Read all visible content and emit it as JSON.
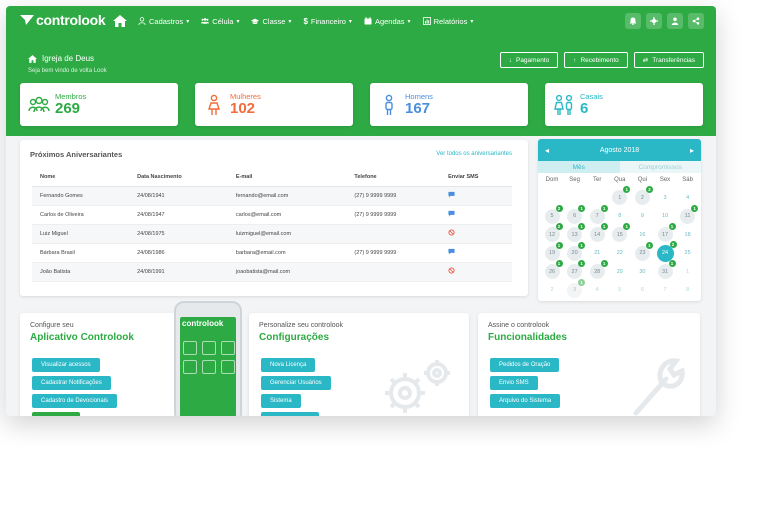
{
  "app": {
    "logo_text": "controlook",
    "colors": {
      "primary": "#2eaa44",
      "accent": "#2ab8c6",
      "orange": "#f26b3a",
      "blue": "#4a8ee0"
    }
  },
  "nav": {
    "menu": [
      {
        "label": "Cadastros",
        "icon": "user-icon"
      },
      {
        "label": "Célula",
        "icon": "group-icon"
      },
      {
        "label": "Classe",
        "icon": "graduation-icon"
      },
      {
        "label": "Financeiro",
        "icon": "dollar-icon"
      },
      {
        "label": "Agendas",
        "icon": "calendar-icon"
      },
      {
        "label": "Relatórios",
        "icon": "chart-icon"
      }
    ],
    "right_icons": [
      "bell-icon",
      "gear-icon",
      "user-icon",
      "share-icon"
    ]
  },
  "header": {
    "org_name": "Igreja de Deus",
    "welcome": "Seja bem vindo de volta Look",
    "actions": [
      {
        "label": "Pagamento",
        "icon": "arrow-down-icon"
      },
      {
        "label": "Recebimento",
        "icon": "arrow-up-icon"
      },
      {
        "label": "Transferências",
        "icon": "transfer-icon"
      }
    ]
  },
  "stats": [
    {
      "label": "Membros",
      "value": "269",
      "color": "#2eaa44",
      "icon": "members-icon"
    },
    {
      "label": "Mulheres",
      "value": "102",
      "color": "#f26b3a",
      "icon": "woman-icon"
    },
    {
      "label": "Homens",
      "value": "167",
      "color": "#4a8ee0",
      "icon": "man-icon"
    },
    {
      "label": "Casais",
      "value": "6",
      "color": "#2ab8c6",
      "icon": "couple-icon"
    }
  ],
  "birthdays": {
    "title": "Próximos Aniversariantes",
    "link": "Ver todos os aniversariantes",
    "columns": [
      "Nome",
      "Data Nascimento",
      "E-mail",
      "Telefone",
      "Enviar SMS"
    ],
    "rows": [
      {
        "name": "Fernando Gomes",
        "date": "24/08/1941",
        "email": "fernando@email.com",
        "phone": "(27) 9 9999 9999",
        "sms": "chat"
      },
      {
        "name": "Carlos de Oliveira",
        "date": "24/08/1947",
        "email": "carlos@email.com",
        "phone": "(27) 9 9999 9999",
        "sms": "chat"
      },
      {
        "name": "Luiz Miguel",
        "date": "24/08/1975",
        "email": "luizmiguel@email.com",
        "phone": "",
        "sms": "blocked"
      },
      {
        "name": "Bárbara Brasil",
        "date": "24/08/1986",
        "email": "barbara@email.com",
        "phone": "(27) 9 9999 9999",
        "sms": "chat"
      },
      {
        "name": "João Batista",
        "date": "24/08/1991",
        "email": "joaobatista@mail.com",
        "phone": "",
        "sms": "blocked"
      }
    ]
  },
  "calendar": {
    "month": "Agosto 2018",
    "tabs": [
      "Mês",
      "Compromissos"
    ],
    "weekdays": [
      "Dom",
      "Seg",
      "Ter",
      "Qua",
      "Qui",
      "Sex",
      "Sáb"
    ],
    "today": 24,
    "days": [
      {
        "d": "1",
        "b": "1"
      },
      {
        "d": "2",
        "b": "3"
      },
      {
        "d": "3",
        "b": ""
      },
      {
        "d": "4",
        "b": ""
      },
      {
        "d": "5",
        "b": "2"
      },
      {
        "d": "6",
        "b": "1"
      },
      {
        "d": "7",
        "b": "1"
      },
      {
        "d": "8",
        "b": ""
      },
      {
        "d": "9",
        "b": ""
      },
      {
        "d": "10",
        "b": ""
      },
      {
        "d": "11",
        "b": "1"
      },
      {
        "d": "12",
        "b": "2"
      },
      {
        "d": "13",
        "b": "1"
      },
      {
        "d": "14",
        "b": "1"
      },
      {
        "d": "15",
        "b": "1"
      },
      {
        "d": "16",
        "b": ""
      },
      {
        "d": "17",
        "b": "1"
      },
      {
        "d": "18",
        "b": ""
      },
      {
        "d": "19",
        "b": "1"
      },
      {
        "d": "20",
        "b": "1"
      },
      {
        "d": "21",
        "b": ""
      },
      {
        "d": "22",
        "b": ""
      },
      {
        "d": "23",
        "b": "1"
      },
      {
        "d": "24",
        "b": "2"
      },
      {
        "d": "25",
        "b": ""
      },
      {
        "d": "26",
        "b": "1"
      },
      {
        "d": "27",
        "b": "1"
      },
      {
        "d": "28",
        "b": "1"
      },
      {
        "d": "29",
        "b": ""
      },
      {
        "d": "30",
        "b": ""
      },
      {
        "d": "31",
        "b": "1"
      },
      {
        "d": "1",
        "b": ""
      },
      {
        "d": "2",
        "b": ""
      },
      {
        "d": "3",
        "b": "1"
      },
      {
        "d": "4",
        "b": ""
      },
      {
        "d": "5",
        "b": ""
      },
      {
        "d": "6",
        "b": ""
      },
      {
        "d": "7",
        "b": ""
      },
      {
        "d": "8",
        "b": ""
      }
    ]
  },
  "cards": {
    "app": {
      "sub": "Configure seu",
      "big": "Aplicativo Controlook",
      "buttons": [
        "Visualizar acessos",
        "Cadastrar Notificações",
        "Cadastro de Devocionais"
      ]
    },
    "config": {
      "sub": "Personalize seu controlook",
      "big": "Configurações",
      "buttons": [
        "Nova Licença",
        "Gerenciar Usuários",
        "Sistema"
      ]
    },
    "features": {
      "sub": "Assine o controlook",
      "big": "Funcionalidades",
      "buttons": [
        "Pedidos de Oração",
        "Envio SMS",
        "Arquivo do Sistema"
      ]
    }
  }
}
